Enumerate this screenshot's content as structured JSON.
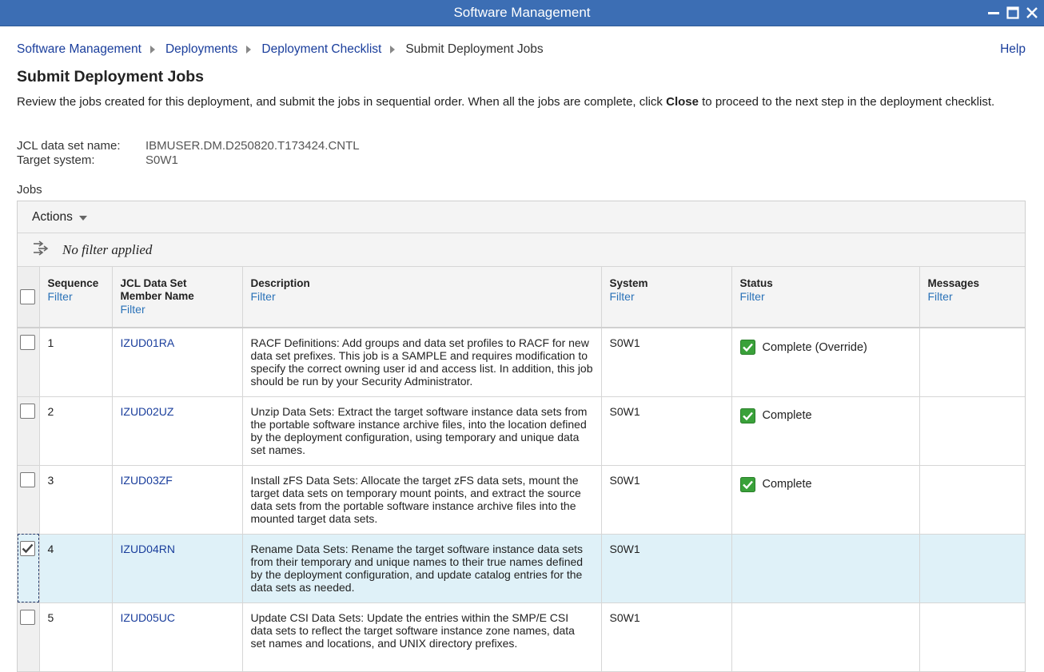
{
  "window": {
    "title": "Software Management"
  },
  "breadcrumb": {
    "items": [
      "Software Management",
      "Deployments",
      "Deployment Checklist"
    ],
    "current": "Submit Deployment Jobs"
  },
  "help_label": "Help",
  "page_title": "Submit Deployment Jobs",
  "intro": {
    "before": "Review the jobs created for this deployment, and submit the jobs in sequential order. When all the jobs are complete, click ",
    "bold": "Close",
    "after": " to proceed to the next step in the deployment checklist."
  },
  "meta": {
    "jcl_label": "JCL data set name:",
    "jcl_value": "IBMUSER.DM.D250820.T173424.CNTL",
    "system_label": "Target system:",
    "system_value": "S0W1"
  },
  "jobs_label": "Jobs",
  "actions_label": "Actions",
  "filter_status": "No filter applied",
  "columns": {
    "sequence": "Sequence",
    "member_line1": "JCL Data Set",
    "member_line2": "Member Name",
    "description": "Description",
    "system": "System",
    "status": "Status",
    "messages": "Messages",
    "filter_link": "Filter"
  },
  "rows": [
    {
      "sequence": "1",
      "member": "IZUD01RA",
      "description": "RACF Definitions: Add groups and data set profiles to RACF for new data set prefixes. This job is a SAMPLE and requires modification to specify the correct owning user id and access list. In addition, this job should be run by your Security Administrator.",
      "system": "S0W1",
      "status": "Complete (Override)",
      "messages": ""
    },
    {
      "sequence": "2",
      "member": "IZUD02UZ",
      "description": "Unzip Data Sets: Extract the target software instance data sets from the portable software instance archive files, into the location defined by the deployment configuration, using temporary and unique data set names.",
      "system": "S0W1",
      "status": "Complete",
      "messages": ""
    },
    {
      "sequence": "3",
      "member": "IZUD03ZF",
      "description": "Install zFS Data Sets: Allocate the target zFS data sets, mount the target data sets on temporary mount points, and extract the source data sets from the portable software instance archive files into the mounted target data sets.",
      "system": "S0W1",
      "status": "Complete",
      "messages": ""
    },
    {
      "sequence": "4",
      "member": "IZUD04RN",
      "description": "Rename Data Sets: Rename the target software instance data sets from their temporary and unique names to their true names defined by the deployment configuration, and update catalog entries for the data sets as needed.",
      "system": "S0W1",
      "status": "",
      "messages": ""
    },
    {
      "sequence": "5",
      "member": "IZUD05UC",
      "description": "Update CSI Data Sets: Update the entries within the SMP/E CSI data sets to reflect the target software instance zone names, data set names and locations, and UNIX directory prefixes.",
      "system": "S0W1",
      "status": "",
      "messages": ""
    }
  ],
  "colors": {
    "titlebar": "#3c6eb4",
    "link": "#1a3e9c",
    "filter_link": "#2a72b8",
    "selected_row": "#dff1f8",
    "complete_icon": "#3aa13a"
  },
  "icons": {
    "minimize": "minimize-icon",
    "maximize": "maximize-icon",
    "close": "close-icon",
    "breadcrumb_separator": "chevron-right-icon",
    "actions_dropdown": "caret-down-icon",
    "filter": "filter-arrows-icon",
    "status_complete": "check-complete-icon"
  }
}
